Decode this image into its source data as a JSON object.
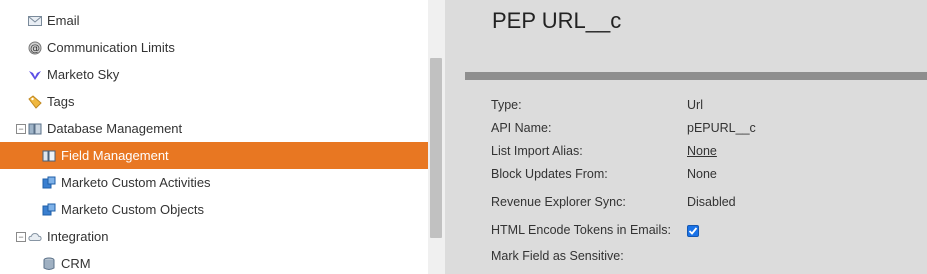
{
  "tree": {
    "items": [
      {
        "label": "Email",
        "icon": "email-icon"
      },
      {
        "label": "Communication Limits",
        "icon": "at-sign-icon"
      },
      {
        "label": "Marketo Sky",
        "icon": "marketo-sky-icon"
      },
      {
        "label": "Tags",
        "icon": "tag-icon"
      },
      {
        "label": "Database Management",
        "icon": "database-icon",
        "expanded": true
      },
      {
        "label": "Field Management",
        "icon": "field-management-icon",
        "selected": true
      },
      {
        "label": "Marketo Custom Activities",
        "icon": "custom-activities-icon"
      },
      {
        "label": "Marketo Custom Objects",
        "icon": "custom-objects-icon"
      },
      {
        "label": "Integration",
        "icon": "cloud-icon",
        "expanded": true
      },
      {
        "label": "CRM",
        "icon": "crm-database-icon"
      }
    ]
  },
  "detail": {
    "title": "PEP URL__c",
    "type_label": "Type:",
    "type_value": "Url",
    "api_label": "API Name:",
    "api_value": "pEPURL__c",
    "alias_label": "List Import Alias:",
    "alias_value": "None",
    "block_label": "Block Updates From:",
    "block_value": "None",
    "revenue_label": "Revenue Explorer Sync:",
    "revenue_value": "Disabled",
    "html_label": "HTML Encode Tokens in Emails:",
    "html_checked": true,
    "sensitive_label": "Mark Field as Sensitive:"
  },
  "colors": {
    "selected_bg": "#e87722",
    "panel_bg": "#dcdcdc"
  }
}
